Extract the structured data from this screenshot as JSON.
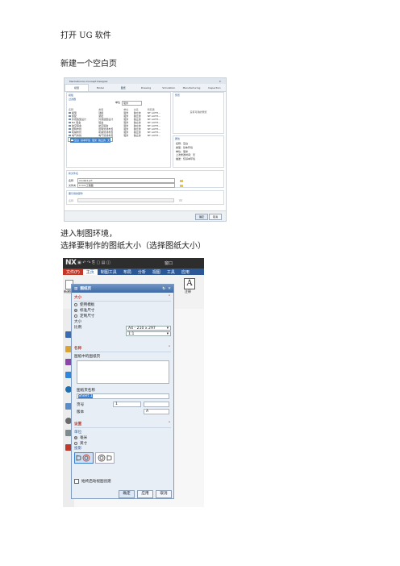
{
  "doc": {
    "para1": "打开 UG 软件",
    "para2": "新建一个空白页",
    "para3": "进入制图环境，",
    "para4": "选择要制作的图纸大小（选择图纸大小）"
  },
  "newfile": {
    "window_title": "Mechatronics Concept Designer",
    "tabs": [
      "模型",
      "Model",
      "图纸",
      "Drawing",
      "Simulation",
      "Manufacturing",
      "Inspection"
    ],
    "section_template": "模板",
    "filter_label": "过滤器",
    "unit_label": "单位",
    "unit_value": "毫米",
    "preview_label": "预览",
    "preview_text": "没有可用的预览",
    "props_label": "属性",
    "columns": [
      "名称",
      "类型",
      "单位",
      "关系",
      "所有者"
    ],
    "rows": [
      [
        "模型",
        "建模",
        "毫米",
        "独立的",
        "NT AUTH..."
      ],
      [
        "装配",
        "装配",
        "毫米",
        "独立的",
        "NT AUTH..."
      ],
      [
        "外观造型设计",
        "外观造型设计",
        "毫米",
        "独立的",
        "NT AUTH..."
      ],
      [
        "NX 钣金",
        "钣金",
        "毫米",
        "独立的",
        "NT AUTH..."
      ],
      [
        "航空钣金",
        "航空钣金",
        "毫米",
        "独立的",
        "NT AUTH..."
      ],
      [
        "逻辑布线",
        "逻辑管线布置",
        "毫米",
        "独立的",
        "NT AUTH..."
      ],
      [
        "机械布管",
        "机械管线布置",
        "毫米",
        "独立的",
        "NT AUTH..."
      ],
      [
        "电气布线",
        "电气管线布置",
        "毫米",
        "独立的",
        "NT AUTH..."
      ],
      [
        "空白",
        "基本环境",
        "毫米",
        "独立的",
        "无"
      ]
    ],
    "props_lines": [
      "名称：空白",
      "类型：基本环境",
      "单位：毫米",
      "上次修改时间：无",
      "描述：仅基本环境"
    ],
    "newfile_section": "新文件名",
    "name_label": "名称",
    "name_value": "model1.prt",
    "folder_label": "文件夹",
    "folder_value": "C:\\lin\\工程图",
    "ref_section": "要引用的部件",
    "ref_label": "名称",
    "ok": "确定",
    "cancel": "取消"
  },
  "nx": {
    "logo": "NX",
    "menu": [
      "文件(F)",
      "主页",
      "制图工具",
      "布局",
      "分析",
      "视图",
      "工具",
      "应用"
    ],
    "window_label": "窗口",
    "ribbon_button": "新建图纸页",
    "note_label": "注释",
    "sheet_dialog": {
      "title": "图纸页",
      "size_group": "大小",
      "opt1": "使用模板",
      "opt2": "标准尺寸",
      "opt3": "定制尺寸",
      "size_label": "大小",
      "size_value": "A4 - 210 x 297",
      "scale_label": "比例",
      "scale_value": "1:1",
      "name_group": "名称",
      "existing_label": "图纸中的图纸页",
      "sheet_name_label": "图纸页名称",
      "sheet_name_value": "Sheet 1",
      "page_label": "页号",
      "page_value": "1",
      "rev_label": "版本",
      "rev_value": "A",
      "settings_group": "设置",
      "units_label": "单位",
      "unit_mm": "毫米",
      "unit_in": "英寸",
      "proj_label": "投影",
      "auto_view": "始终启动视图创建",
      "ok": "确定",
      "apply": "应用",
      "cancel": "取消"
    }
  }
}
